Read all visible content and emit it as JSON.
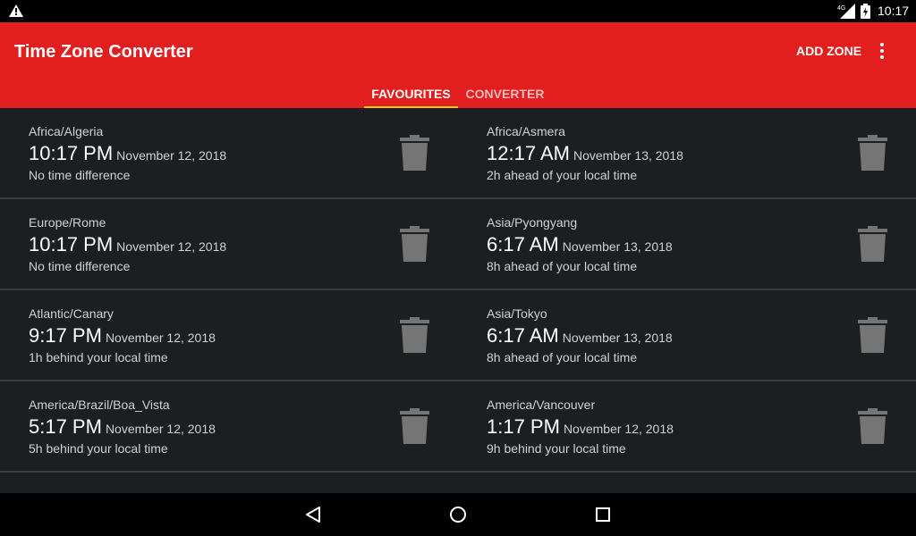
{
  "status_bar": {
    "network": "4G",
    "time": "10:17"
  },
  "app_bar": {
    "title": "Time Zone Converter",
    "add_zone_label": "ADD ZONE",
    "accent_color": "#e21e1e",
    "tab_indicator_color": "#f5c400"
  },
  "tabs": [
    {
      "label": "FAVOURITES",
      "selected": true
    },
    {
      "label": "CONVERTER",
      "selected": false
    }
  ],
  "zones": [
    {
      "name": "Africa/Algeria",
      "time": "10:17 PM",
      "date": "November 12, 2018",
      "diff": "No time difference"
    },
    {
      "name": "Africa/Asmera",
      "time": "12:17 AM",
      "date": "November 13, 2018",
      "diff": "2h ahead of your local time"
    },
    {
      "name": "Europe/Rome",
      "time": "10:17 PM",
      "date": "November 12, 2018",
      "diff": "No time difference"
    },
    {
      "name": "Asia/Pyongyang",
      "time": "6:17 AM",
      "date": "November 13, 2018",
      "diff": "8h ahead of your local time"
    },
    {
      "name": "Atlantic/Canary",
      "time": "9:17 PM",
      "date": "November 12, 2018",
      "diff": "1h behind your local time"
    },
    {
      "name": "Asia/Tokyo",
      "time": "6:17 AM",
      "date": "November 13, 2018",
      "diff": "8h ahead of your local time"
    },
    {
      "name": "America/Brazil/Boa_Vista",
      "time": "5:17 PM",
      "date": "November 12, 2018",
      "diff": "5h behind your local time"
    },
    {
      "name": "America/Vancouver",
      "time": "1:17 PM",
      "date": "November 12, 2018",
      "diff": "9h behind your local time"
    }
  ],
  "icons": {
    "status": [
      "warning-icon",
      "signal-icon",
      "battery-icon"
    ],
    "row_action": "trash-icon",
    "overflow": "more-vert-icon",
    "navigation": [
      "back-icon",
      "home-icon",
      "recents-icon"
    ]
  }
}
